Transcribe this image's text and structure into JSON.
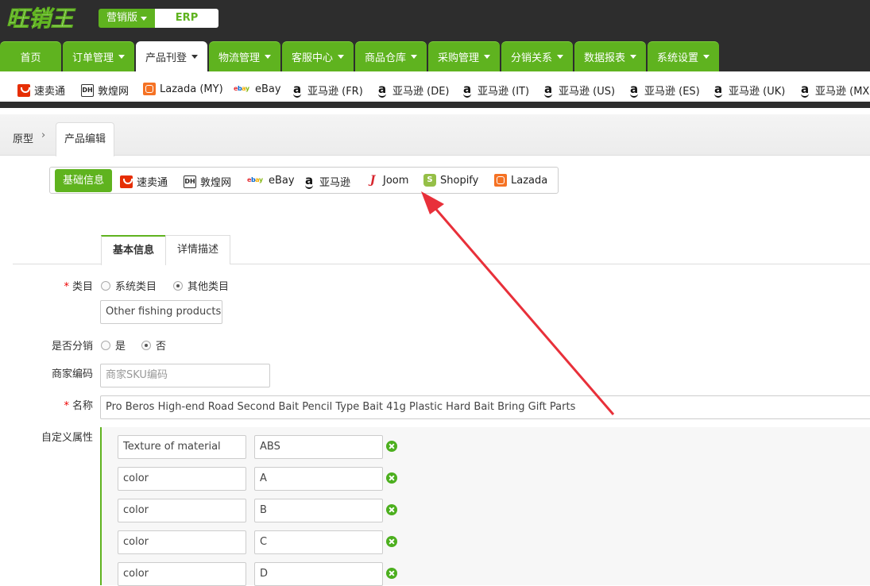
{
  "header": {
    "logo_text": "旺销王",
    "edition_label": "营销版",
    "erp_label": "ERP"
  },
  "nav": [
    {
      "label": "首页",
      "dropdown": false
    },
    {
      "label": "订单管理",
      "dropdown": true
    },
    {
      "label": "产品刊登",
      "dropdown": true,
      "active": true
    },
    {
      "label": "物流管理",
      "dropdown": true
    },
    {
      "label": "客服中心",
      "dropdown": true
    },
    {
      "label": "商品仓库",
      "dropdown": true
    },
    {
      "label": "采购管理",
      "dropdown": true
    },
    {
      "label": "分销关系",
      "dropdown": true
    },
    {
      "label": "数据报表",
      "dropdown": true
    },
    {
      "label": "系统设置",
      "dropdown": true
    }
  ],
  "platforms": [
    {
      "label": "速卖通",
      "icon": "aliexpress-icon"
    },
    {
      "label": "敦煌网",
      "icon": "dhgate-icon"
    },
    {
      "label": "Lazada (MY)",
      "icon": "lazada-icon"
    },
    {
      "label": "eBay",
      "icon": "ebay-icon"
    },
    {
      "label": "亚马逊 (FR)",
      "icon": "amazon-icon"
    },
    {
      "label": "亚马逊 (DE)",
      "icon": "amazon-icon"
    },
    {
      "label": "亚马逊 (IT)",
      "icon": "amazon-icon"
    },
    {
      "label": "亚马逊 (US)",
      "icon": "amazon-icon"
    },
    {
      "label": "亚马逊 (ES)",
      "icon": "amazon-icon"
    },
    {
      "label": "亚马逊 (UK)",
      "icon": "amazon-icon"
    },
    {
      "label": "亚马逊 (MX)",
      "icon": "amazon-icon"
    }
  ],
  "breadcrumb": {
    "home": "原型",
    "separator": "›",
    "current": "产品编辑"
  },
  "selector": {
    "active": "基础信息",
    "items": [
      {
        "label": "速卖通",
        "icon": "aliexpress-icon"
      },
      {
        "label": "敦煌网",
        "icon": "dhgate-icon"
      },
      {
        "label": "eBay",
        "icon": "ebay-icon"
      },
      {
        "label": "亚马逊",
        "icon": "amazon-icon"
      },
      {
        "label": "Joom",
        "icon": "joom-icon"
      },
      {
        "label": "Shopify",
        "icon": "shopify-icon"
      },
      {
        "label": "Lazada",
        "icon": "lazada-icon"
      }
    ]
  },
  "tabs": {
    "basic": "基本信息",
    "detail": "详情描述"
  },
  "form": {
    "category": {
      "label": "类目",
      "option_system": "系统类目",
      "option_other": "其他类目",
      "selected": "其他类目",
      "value": "Other fishing products"
    },
    "distribution": {
      "label": "是否分销",
      "option_yes": "是",
      "option_no": "否",
      "selected": "否"
    },
    "sku": {
      "label": "商家编码",
      "placeholder": "商家SKU编码",
      "value": ""
    },
    "name": {
      "label": "名称",
      "value": "Pro Beros High-end Road Second Bait Pencil Type Bait 41g Plastic Hard Bait Bring Gift Parts"
    },
    "custom_attrs": {
      "label": "自定义属性",
      "rows": [
        {
          "key": "Texture of material",
          "value": "ABS"
        },
        {
          "key": "color",
          "value": "A"
        },
        {
          "key": "color",
          "value": "B"
        },
        {
          "key": "color",
          "value": "C"
        },
        {
          "key": "color",
          "value": "D"
        }
      ]
    }
  },
  "colors": {
    "brand_green": "#5fb31f",
    "header_dark": "#2d2d2d",
    "annotation_red": "#e8303a"
  }
}
